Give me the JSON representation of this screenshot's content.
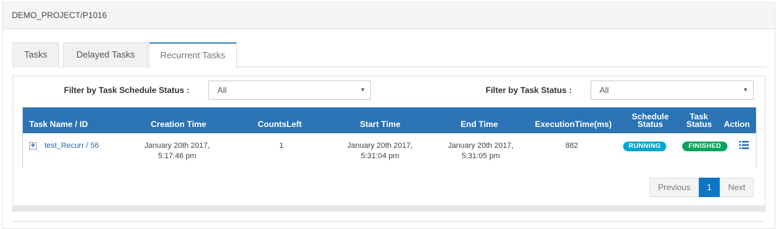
{
  "header": {
    "title": "DEMO_PROJECT/P1016"
  },
  "tabs": [
    {
      "label": "Tasks"
    },
    {
      "label": "Delayed Tasks"
    },
    {
      "label": "Recurrent Tasks",
      "active": true
    }
  ],
  "filters": {
    "schedule_label": "Filter by Task Schedule Status :",
    "schedule_value": "All",
    "task_label": "Filter by Task Status :",
    "task_value": "All"
  },
  "table": {
    "columns": {
      "name": "Task Name / ID",
      "creation": "Creation Time",
      "counts": "CountsLeft",
      "start": "Start Time",
      "end": "End Time",
      "exec": "ExecutionTime(ms)",
      "schedule_l1": "Schedule",
      "schedule_l2": "Status",
      "task_l1": "Task",
      "task_l2": "Status",
      "action": "Action"
    },
    "rows": [
      {
        "expand_glyph": "+",
        "name": "test_Recurr / 56",
        "creation_l1": "January 20th 2017,",
        "creation_l2": "5:17:46 pm",
        "counts_left": "1",
        "start_l1": "January 20th 2017,",
        "start_l2": "5:31:04 pm",
        "end_l1": "January 20th 2017,",
        "end_l2": "5:31:05 pm",
        "exec_time": "882",
        "schedule_status": "RUNNING",
        "task_status": "FINISHED",
        "action_icon": "list-icon"
      }
    ]
  },
  "pagination": {
    "prev": "Previous",
    "current": "1",
    "next": "Next"
  },
  "colors": {
    "header_blue": "#2b73b4",
    "running": "#00a7d0",
    "finished": "#00a65a",
    "active_page": "#0d76c4"
  }
}
